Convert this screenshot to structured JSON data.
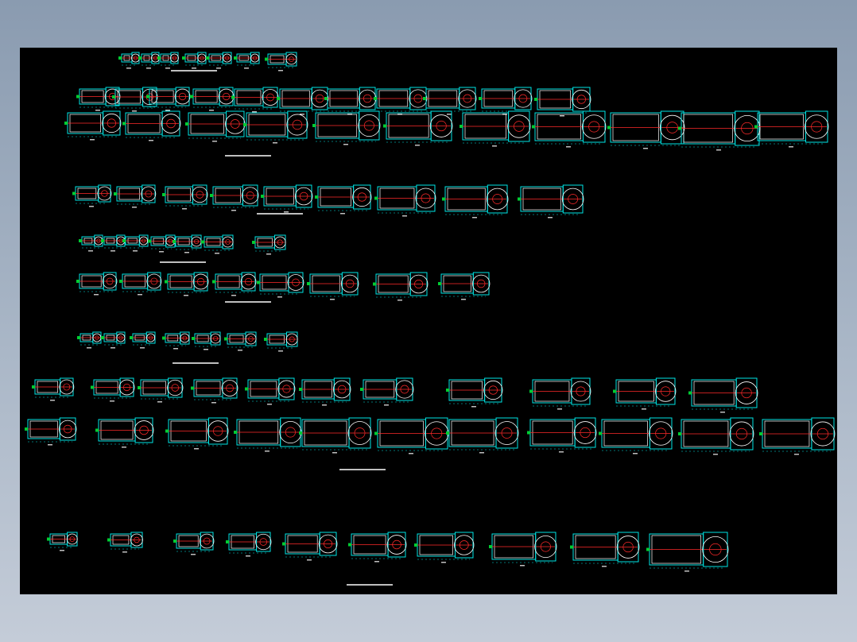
{
  "drawing": {
    "background": "#000000",
    "colors": {
      "body_outline": "#00e5e5",
      "centerline": "#ff2a2a",
      "motor_outline": "#ffffff",
      "flange_marker": "#00cc33",
      "label": "#bfbfbf",
      "dimension": "#00e5e5"
    },
    "section_titles": [
      "",
      "",
      "",
      "",
      "",
      "",
      "",
      ""
    ],
    "rows": [
      {
        "name": "row-1",
        "count": 7
      },
      {
        "name": "row-2",
        "count": 10
      },
      {
        "name": "row-3",
        "count": 11
      },
      {
        "name": "row-4",
        "count": 9
      },
      {
        "name": "row-5",
        "count": 7
      },
      {
        "name": "row-6",
        "count": 8
      },
      {
        "name": "row-7",
        "count": 7
      },
      {
        "name": "row-8",
        "count": 11
      },
      {
        "name": "row-9",
        "count": 12
      },
      {
        "name": "row-10",
        "count": 11
      }
    ]
  }
}
